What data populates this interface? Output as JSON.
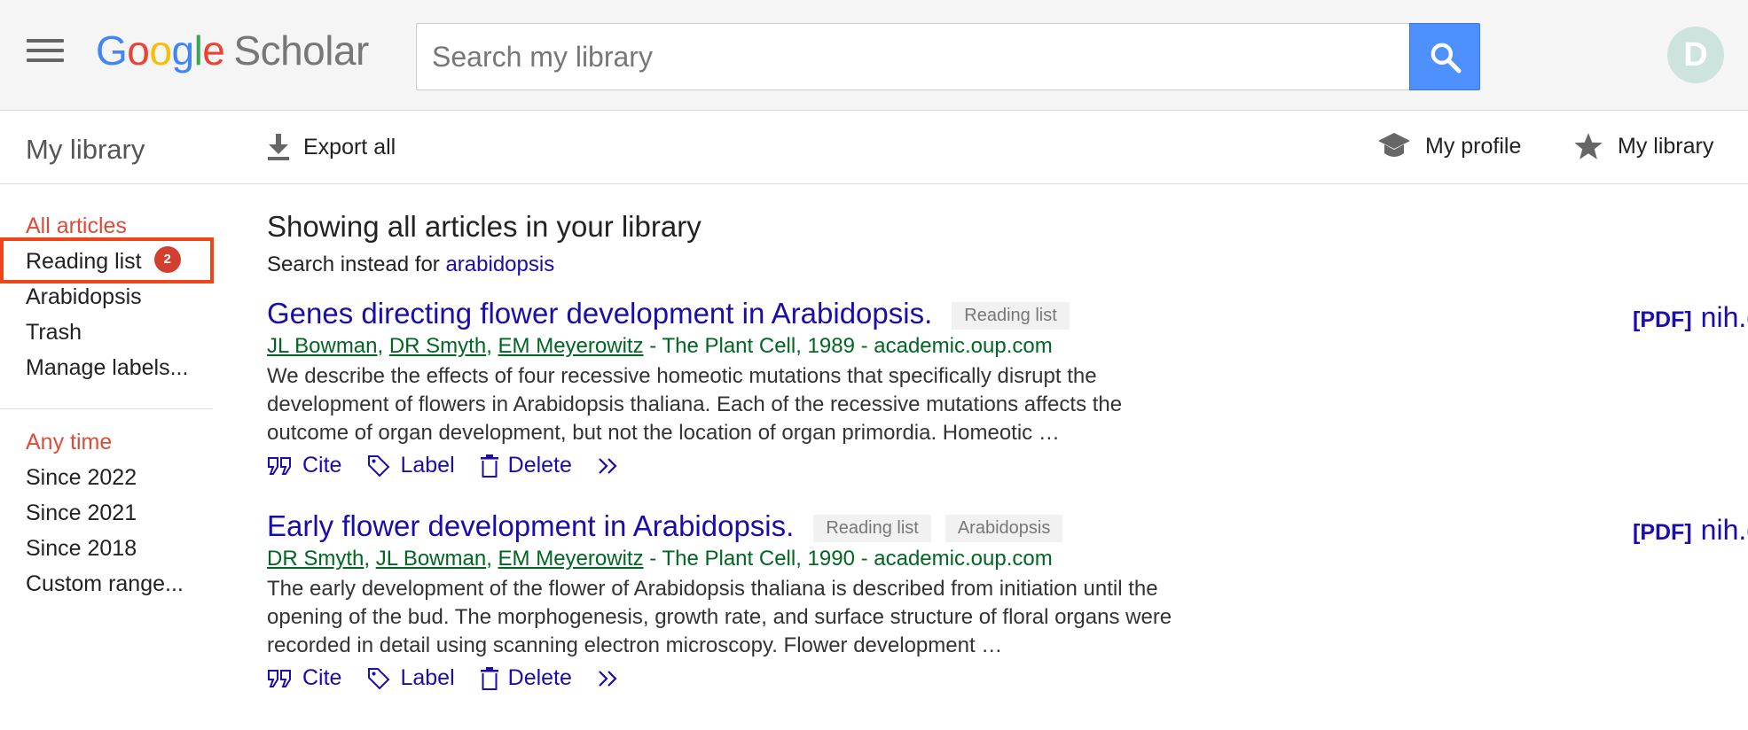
{
  "header": {
    "logo_letters": [
      "G",
      "o",
      "o",
      "g",
      "l",
      "e"
    ],
    "logo_product": "Scholar",
    "search_placeholder": "Search my library",
    "avatar_initial": "D"
  },
  "toolbar": {
    "title": "My library",
    "export_label": "Export all",
    "my_profile_label": "My profile",
    "my_library_label": "My library"
  },
  "sidebar": {
    "labels": [
      {
        "label": "All articles",
        "active": true
      },
      {
        "label": "Reading list",
        "badge": "2"
      },
      {
        "label": "Arabidopsis"
      },
      {
        "label": "Trash"
      },
      {
        "label": "Manage labels..."
      }
    ],
    "time_heading": "Any time",
    "time_filters": [
      "Since 2022",
      "Since 2021",
      "Since 2018",
      "Custom range..."
    ]
  },
  "main": {
    "heading": "Showing all articles in your library",
    "search_instead_prefix": "Search instead for",
    "search_instead_query": "arabidopsis"
  },
  "results": [
    {
      "title": "Genes directing flower development in Arabidopsis.",
      "tags": [
        "Reading list"
      ],
      "authors": [
        "JL Bowman",
        "DR Smyth",
        "EM Meyerowitz"
      ],
      "source": " - The Plant Cell, 1989 - academic.oup.com",
      "snippet": "We describe the effects of four recessive homeotic mutations that specifically disrupt the development of flowers in Arabidopsis thaliana. Each of the recessive mutations affects the outcome of organ development, but not the location of organ primordia. Homeotic …",
      "pdf_tag": "[PDF]",
      "pdf_source": "nih.gov"
    },
    {
      "title": "Early flower development in Arabidopsis.",
      "tags": [
        "Reading list",
        "Arabidopsis"
      ],
      "authors": [
        "DR Smyth",
        "JL Bowman",
        "EM Meyerowitz"
      ],
      "source": " - The Plant Cell, 1990 - academic.oup.com",
      "snippet": "The early development of the flower of Arabidopsis thaliana is described from initiation until the opening of the bud. The morphogenesis, growth rate, and surface structure of floral organs were recorded in detail using scanning electron microscopy. Flower development …",
      "pdf_tag": "[PDF]",
      "pdf_source": "nih.gov"
    }
  ],
  "actions": {
    "cite": "Cite",
    "label": "Label",
    "delete": "Delete"
  },
  "colors": {
    "link": "#1a0dab",
    "author_green": "#006621",
    "active_red": "#dd4b39",
    "highlight_orange": "#f0441c",
    "search_button_blue": "#4d90fe"
  }
}
